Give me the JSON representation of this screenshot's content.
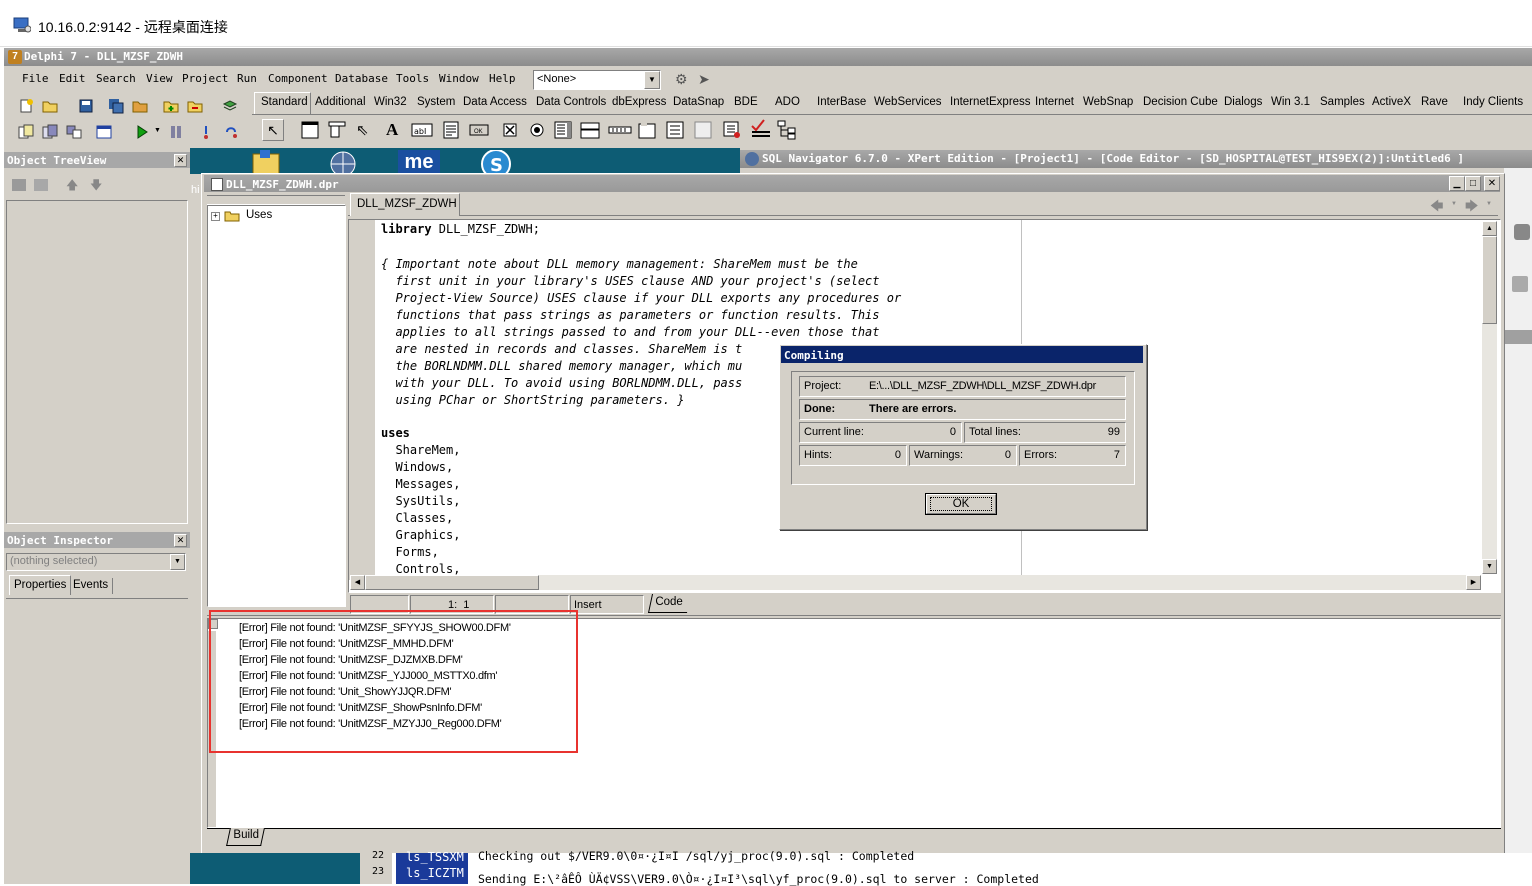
{
  "rdp": {
    "title": "10.16.0.2:9142 - 远程桌面连接"
  },
  "ide": {
    "title": "Delphi 7 - DLL_MZSF_ZDWH",
    "menu": [
      "File",
      "Edit",
      "Search",
      "View",
      "Project",
      "Run",
      "Component",
      "Database",
      "Tools",
      "Window",
      "Help"
    ],
    "config_combo": "<None>",
    "palette_tabs": [
      "Standard",
      "Additional",
      "Win32",
      "System",
      "Data Access",
      "Data Controls",
      "dbExpress",
      "DataSnap",
      "BDE",
      "ADO",
      "InterBase",
      "WebServices",
      "InternetExpress",
      "Internet",
      "WebSnap",
      "Decision Cube",
      "Dialogs",
      "Win 3.1",
      "Samples",
      "ActiveX",
      "Rave",
      "Indy Clients"
    ]
  },
  "tree_view": {
    "title": "Object TreeView"
  },
  "inspector": {
    "title": "Object Inspector",
    "selection": "(nothing selected)",
    "tabs": [
      "Properties",
      "Events"
    ]
  },
  "sqlnav": {
    "title": "SQL Navigator 6.7.0 - XPert Edition - [Project1] - [Code Editor - [SD_HOSPITAL@TEST_HIS9EX(2)]:Untitled6 ]"
  },
  "editor": {
    "title": "DLL_MZSF_ZDWH.dpr",
    "tab": "DLL_MZSF_ZDWH",
    "explorer_node": "Uses",
    "code": [
      {
        "kw": "library",
        "rest": " DLL_MZSF_ZDWH;"
      },
      {
        "c": ""
      },
      {
        "c": "{ Important note about DLL memory management: ShareMem must be the"
      },
      {
        "c": "  first unit in your library's USES clause AND your project's (select"
      },
      {
        "c": "  Project-View Source) USES clause if your DLL exports any procedures or"
      },
      {
        "c": "  functions that pass strings as parameters or function results. This"
      },
      {
        "c": "  applies to all strings passed to and from your DLL--even those that"
      },
      {
        "c": "  are nested in records and classes. ShareMem is t"
      },
      {
        "c": "  the BORLNDMM.DLL shared memory manager, which mu"
      },
      {
        "c": "  with your DLL. To avoid using BORLNDMM.DLL, pass"
      },
      {
        "c": "  using PChar or ShortString parameters. }"
      },
      {
        "c": ""
      },
      {
        "kw": "uses",
        "rest": ""
      },
      {
        "p": "  ShareMem,"
      },
      {
        "p": "  Windows,"
      },
      {
        "p": "  Messages,"
      },
      {
        "p": "  SysUtils,"
      },
      {
        "p": "  Classes,"
      },
      {
        "p": "  Graphics,"
      },
      {
        "p": "  Forms,"
      },
      {
        "p": "  Controls,"
      }
    ],
    "status": {
      "position": "1:  1",
      "mode": "Insert",
      "view_tab": "Code"
    },
    "messages": [
      "[Error] File not found: 'UnitMZSF_SFYYJS_SHOW00.DFM'",
      "[Error] File not found: 'UnitMZSF_MMHD.DFM'",
      "[Error] File not found: 'UnitMZSF_DJZMXB.DFM'",
      "[Error] File not found: 'UnitMZSF_YJJ000_MSTTX0.dfm'",
      "[Error] File not found: 'Unit_ShowYJJQR.DFM'",
      "[Error] File not found: 'UnitMZSF_ShowPsnInfo.DFM'",
      "[Error] File not found: 'UnitMZSF_MZYJJ0_Reg000.DFM'"
    ],
    "messages_tab": "Build"
  },
  "compiling": {
    "title": "Compiling",
    "project_label": "Project:",
    "project_value": "E:\\...\\DLL_MZSF_ZDWH\\DLL_MZSF_ZDWH.dpr",
    "done_label": "Done:",
    "done_value": "There are errors.",
    "current_line_label": "Current line:",
    "current_line_value": "0",
    "total_lines_label": "Total lines:",
    "total_lines_value": "99",
    "hints_label": "Hints:",
    "hints_value": "0",
    "warnings_label": "Warnings:",
    "warnings_value": "0",
    "errors_label": "Errors:",
    "errors_value": "7",
    "ok": "OK"
  },
  "background": {
    "line_numbers": [
      "22",
      "23"
    ],
    "items": [
      "ls_TSSXM",
      "ls_ICZTM"
    ],
    "log": [
      "Checking out $/VER9.0\\0¤·¿I¤I /sql/yj_proc(9.0).sql : Completed",
      "Sending E:\\²âÊÔ ÙÄ¢VSS\\VER9.0\\Ò¤·¿I¤I³\\sql\\yf_proc(9.0).sql to server : Completed"
    ]
  },
  "highlight_color": "#e8332f"
}
